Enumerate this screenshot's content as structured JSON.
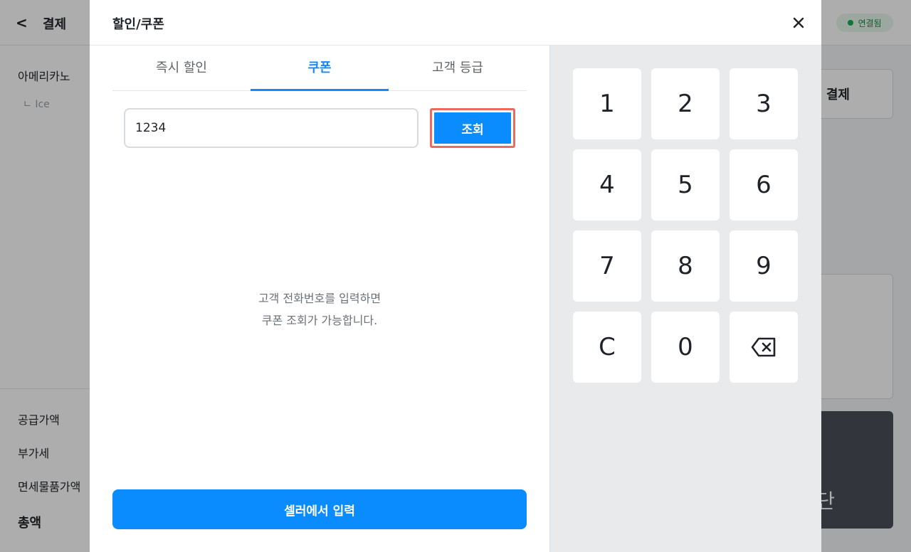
{
  "background": {
    "back_glyph": "<",
    "title": "결제",
    "status": "연결됨",
    "item_name": "아메리카노",
    "item_option": "ㄴ Ice",
    "pay_button": "결제",
    "dark_button": "단",
    "summary": {
      "supply": "공급가액",
      "vat": "부가세",
      "tax_free": "면세물품가액",
      "total": "총액"
    }
  },
  "modal": {
    "title": "할인/쿠폰",
    "tabs": [
      "즉시 할인",
      "쿠폰",
      "고객 등급"
    ],
    "active_tab": "쿠폰",
    "input_value": "1234",
    "lookup_label": "조회",
    "hint_line1": "고객 전화번호를 입력하면",
    "hint_line2": "쿠폰 조회가 가능합니다.",
    "seller_button": "셀러에서 입력"
  },
  "keypad": {
    "keys": [
      "1",
      "2",
      "3",
      "4",
      "5",
      "6",
      "7",
      "8",
      "9",
      "C",
      "0"
    ],
    "backspace_icon": "backspace-icon"
  },
  "colors": {
    "accent": "#0a8cff",
    "highlight_border": "#ec6a5e",
    "status_green": "#1bab57"
  }
}
